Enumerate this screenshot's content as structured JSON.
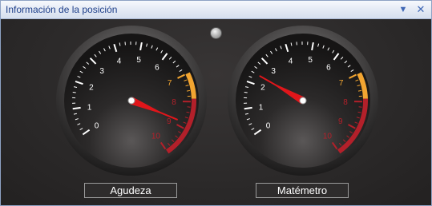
{
  "panel": {
    "title": "Información de la posición",
    "actions": {
      "menu_icon": "chevron-down-icon",
      "close_icon": "close-icon"
    }
  },
  "gauges": [
    {
      "id": "agudeza",
      "label": "Agudeza",
      "scale": {
        "min": 0,
        "max": 10,
        "labels": [
          "0",
          "1",
          "2",
          "3",
          "4",
          "5",
          "6",
          "7",
          "8",
          "9",
          "10"
        ]
      },
      "needle_value": 8.8,
      "warn_start": 7,
      "danger_start": 7.9
    },
    {
      "id": "matemetro",
      "label": "Matémetro",
      "scale": {
        "min": 0,
        "max": 10,
        "labels": [
          "0",
          "1",
          "2",
          "3",
          "4",
          "5",
          "6",
          "7",
          "8",
          "9",
          "10"
        ]
      },
      "needle_value": 2.4,
      "warn_start": 7,
      "danger_start": 7.9
    }
  ],
  "colors": {
    "white_ticks": "#ffffff",
    "warn": "#f2a531",
    "danger": "#b3202a",
    "needle": "#e0161b",
    "title_text": "#1e3f8a"
  }
}
